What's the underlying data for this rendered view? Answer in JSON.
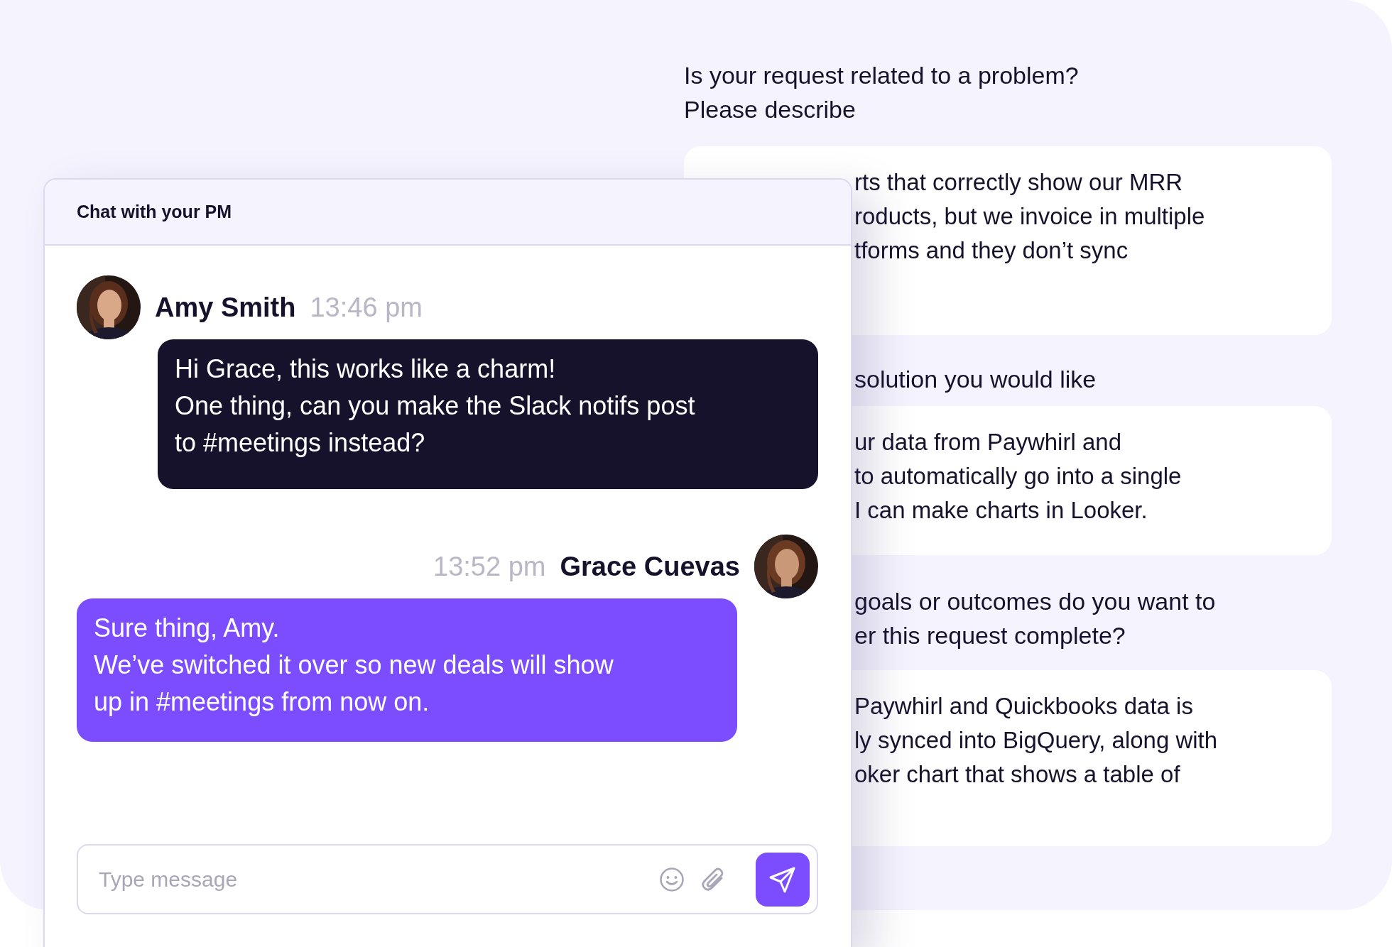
{
  "form": {
    "questions": [
      {
        "question": "Is your request related to a problem?\nPlease describe",
        "answer": "rts that correctly show our MRR\nroducts, but we invoice in multiple\ntforms and they don’t sync"
      },
      {
        "question": "solution you would like",
        "answer": "ur data from Paywhirl and\nto automatically go into a single\nI can make charts in Looker."
      },
      {
        "question": "goals or outcomes do you want to\ner this request complete?",
        "answer": "Paywhirl and Quickbooks data is\nly synced into BigQuery, along with\noker chart that shows a table of"
      }
    ]
  },
  "chat": {
    "title": "Chat with your PM",
    "messages": [
      {
        "kind": "incoming",
        "sender": "Amy Smith",
        "time": "13:46 pm",
        "text": "Hi Grace, this works like a charm!\nOne thing, can you make the Slack notifs post\nto #meetings instead?"
      },
      {
        "kind": "outgoing",
        "sender": "Grace Cuevas",
        "time": "13:52 pm",
        "text": "Sure thing, Amy.\nWe’ve switched it over so new deals will show\nup in #meetings from now on."
      }
    ],
    "input": {
      "placeholder": "Type message"
    }
  }
}
